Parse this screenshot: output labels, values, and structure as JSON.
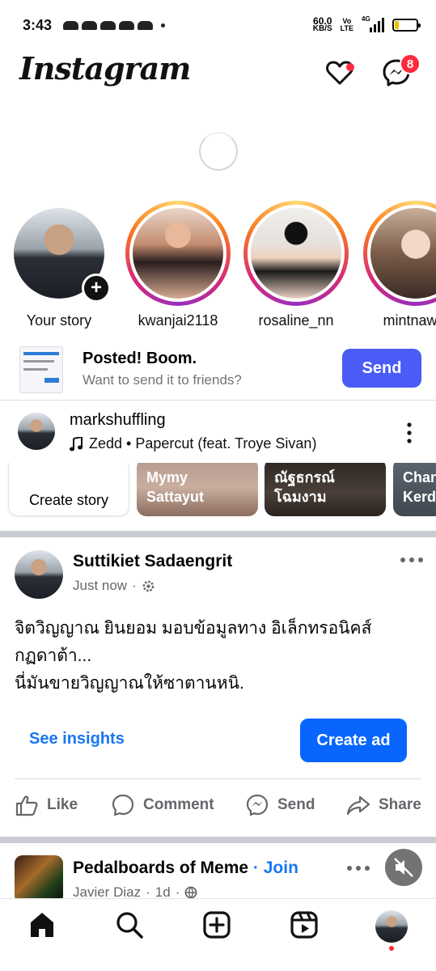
{
  "status_bar": {
    "time": "3:43",
    "net_speed_value": "60.0",
    "net_speed_unit": "KB/S",
    "volte_top": "Vo",
    "volte_bottom": "LTE",
    "network_type": "4G"
  },
  "header": {
    "logo": "Instagram",
    "messages_badge": "8"
  },
  "stories": [
    {
      "name": "Your story"
    },
    {
      "name": "kwanjai2118"
    },
    {
      "name": "rosaline_nn"
    },
    {
      "name": "mintnawin"
    }
  ],
  "posted_banner": {
    "title": "Posted! Boom.",
    "subtitle": "Want to send it to friends?",
    "button": "Send"
  },
  "music_post": {
    "username": "markshuffling",
    "track": "Zedd • Papercut (feat. Troye Sivan)"
  },
  "story_strip": {
    "create_label": "Create story",
    "cards": [
      {
        "label_line1": "Mymy",
        "label_line2": "Sattayut"
      },
      {
        "label_line1": "ณัฐธกรณ์",
        "label_line2": "โฉมงาม"
      },
      {
        "label_line1": "Chan",
        "label_line2": "Kerd"
      }
    ]
  },
  "post": {
    "author": "Suttikiet Sadaengrit",
    "time": "Just now",
    "text_line1": "จิตวิญญาณ ยินยอม มอบข้อมูลทาง อิเล็กทรอนิคส์",
    "text_line2": "กฏดาต้า...",
    "text_line3": "นี่มันขายวิญญาณให้ซาตานหนิ.",
    "see_insights": "See insights",
    "create_ad": "Create ad",
    "actions": {
      "like": "Like",
      "comment": "Comment",
      "send": "Send",
      "share": "Share"
    }
  },
  "next_post": {
    "title": "Pedalboards of Meme",
    "join": "Join",
    "author": "Javier Diaz",
    "time": "1d"
  },
  "colors": {
    "accent_blue": "#1877f2",
    "ig_send": "#4a5bf6",
    "badge_red": "#ff2a3d"
  }
}
